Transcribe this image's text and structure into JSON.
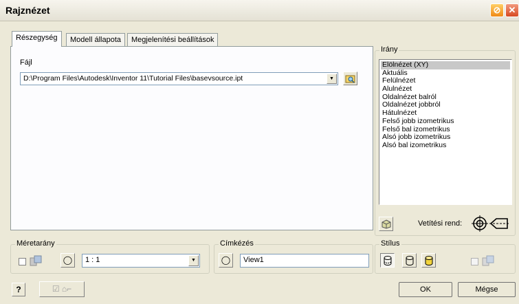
{
  "window": {
    "title": "Rajznézet"
  },
  "tabs": [
    {
      "label": "Részegység"
    },
    {
      "label": "Modell állapota"
    },
    {
      "label": "Megjelenítési beállítások"
    }
  ],
  "file": {
    "label": "Fájl",
    "path": "D:\\Program Files\\Autodesk\\Inventor 11\\Tutorial Files\\basevsource.ipt"
  },
  "direction": {
    "label": "Irány",
    "items": [
      "Elölnézet (XY)",
      "Aktuális",
      "Felülnézet",
      "Alulnézet",
      "Oldalnézet balról",
      "Oldalnézet jobbról",
      "Hátulnézet",
      "Felső jobb izometrikus",
      "Felső bal izometrikus",
      "Alsó jobb izometrikus",
      "Alsó bal izometrikus"
    ],
    "selected": "Elölnézet (XY)",
    "projection_label": "Vetítési rend:"
  },
  "scale": {
    "label": "Méretarány",
    "value": "1 : 1"
  },
  "labeling": {
    "label": "Címkézés",
    "value": "View1"
  },
  "style": {
    "label": "Stílus"
  },
  "buttons": {
    "ok": "OK",
    "cancel": "Mégse"
  }
}
